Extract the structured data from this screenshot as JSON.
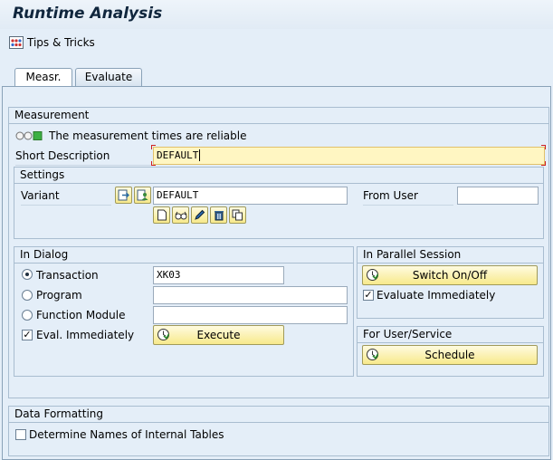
{
  "window": {
    "title": "Runtime Analysis"
  },
  "toolbar": {
    "tips_label": "Tips & Tricks"
  },
  "tabs": [
    {
      "label": "Measr.",
      "active": true
    },
    {
      "label": "Evaluate",
      "active": false
    }
  ],
  "measurement": {
    "title": "Measurement",
    "status_text": "The measurement times are reliable",
    "short_desc_label": "Short Description",
    "short_desc_value": "DEFAULT"
  },
  "settings": {
    "title": "Settings",
    "variant_label": "Variant",
    "variant_value": "DEFAULT",
    "from_user_label": "From User",
    "from_user_value": ""
  },
  "in_dialog": {
    "title": "In Dialog",
    "transaction_label": "Transaction",
    "transaction_value": "XK03",
    "program_label": "Program",
    "program_value": "",
    "function_module_label": "Function Module",
    "function_module_value": "",
    "eval_immediately_label": "Eval. Immediately",
    "execute_label": "Execute",
    "selected": "Transaction",
    "eval_checked": true
  },
  "parallel": {
    "title": "In Parallel Session",
    "switch_label": "Switch On/Off",
    "eval_label": "Evaluate Immediately",
    "eval_checked": true
  },
  "user_service": {
    "title": "For User/Service",
    "schedule_label": "Schedule"
  },
  "data_formatting": {
    "title": "Data Formatting",
    "determine_label": "Determine Names of Internal Tables",
    "determine_checked": false
  },
  "colors": {
    "background": "#e4eef8",
    "button_yellow": "#f7e98b",
    "required_field": "#fff6c2",
    "status_green": "#3cb043"
  }
}
